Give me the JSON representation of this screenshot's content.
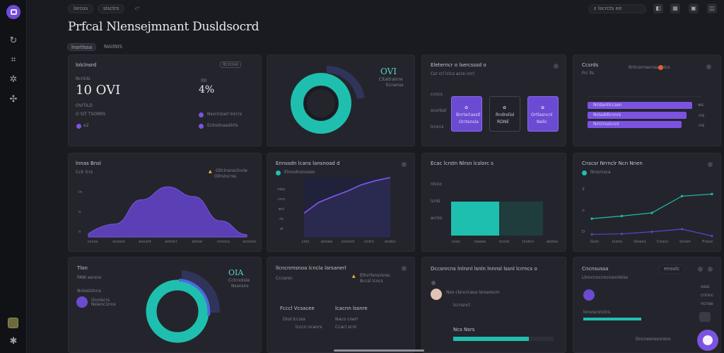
{
  "app": {
    "title": "Prfcal Nlensejmnant Dusldsocrd",
    "brand_color": "#6f4bd8",
    "accent_teal": "#1fbfb0",
    "accent_purple": "#7b53e0"
  },
  "sidebar": {
    "items": [
      {
        "icon": "sync-icon",
        "glyph": "↻"
      },
      {
        "icon": "grid-icon",
        "glyph": "⌗"
      },
      {
        "icon": "settings-icon",
        "glyph": "✲"
      },
      {
        "icon": "team-icon",
        "glyph": "✣"
      },
      {
        "icon": "settings-bottom-icon",
        "glyph": "✱"
      }
    ]
  },
  "topbar": {
    "crumb1": "lsrcos",
    "crumb2": "slsctrs",
    "crumb3": "c°",
    "search": "ɛ lscrcts   ee",
    "badge": "58"
  },
  "tabs": [
    {
      "label": "lnsrtlssa",
      "active": true
    },
    {
      "label": "NAIINIS",
      "active": false
    }
  ],
  "cards": {
    "kpi": {
      "title": "lolclnsrd",
      "sub": "Ncrlnls",
      "value": "10 OVI",
      "meta1": "OVITILD",
      "meta2": "O SIT TSORRS",
      "foot": "e2",
      "box": "ltcrcnin",
      "percent": "4%",
      "leg1": "Nsvrirsiarl lnrcrs",
      "leg2": "Eclnolnaaslirts"
    },
    "donut_top": {
      "value": "OVI",
      "sub1": "Cltaltralnre",
      "sub2": "Ecnanss"
    },
    "kanban": {
      "title": "Eleterncr o lsercsssd o",
      "sub": "Csr rcl lclcs acre nrcl",
      "col1": "Bnrterlasstl",
      "col2": "Rndrellal",
      "col3": "Ortlasncnl",
      "items": [
        "Orrtensla",
        "RDNE",
        "Nellc",
        "Nltna",
        "Pocsa",
        "Neoe"
      ]
    },
    "bars": {
      "title": "Ccsrds",
      "sub": "Frc lls",
      "legend": "Rnlcorrnacnsarlnlcs",
      "labels": [
        "Nrldanllccsen",
        "Noladdlcnnrs",
        "Nrlclrsslcnnl"
      ],
      "values": [
        82,
        78,
        74
      ],
      "ends": [
        "ws",
        "-ns",
        "-ns"
      ]
    },
    "area": {
      "title": "lnnas Bnsl",
      "sub": "Cclr lcrs",
      "warn": "Ollclnsnsclnnle",
      "xticks": [
        "cccss",
        "snosrs",
        "escsnt",
        "onlnnr",
        "olrssr",
        "rcnncs",
        "scnnsn"
      ],
      "ylabels": [
        "ln",
        "n",
        "n"
      ],
      "chart_data": {
        "type": "area",
        "x": [
          0,
          1,
          2,
          3,
          4,
          5,
          6
        ],
        "values": [
          4,
          16,
          46,
          62,
          50,
          20,
          3
        ]
      }
    },
    "line1": {
      "title": "Ennssdn lcans lansnoad d",
      "legend": "Elnnotnsnossn",
      "xticks": [
        "cnlc",
        "onnes",
        "cnnnct",
        "cnlrn",
        "ocdcc"
      ],
      "ylabels": [
        "nlac",
        "cnn",
        "eni",
        "ro",
        "nl"
      ],
      "chart_data": {
        "type": "line",
        "x": [
          0,
          1,
          2,
          3,
          4,
          5,
          6
        ],
        "values": [
          40,
          58,
          68,
          77,
          88,
          95,
          100
        ]
      }
    },
    "stacked": {
      "title": "Ecac lcrstn Nlrsn lcslorc s",
      "ylabels": [
        "nlcco",
        "lcnls",
        "acnlo"
      ],
      "xticks": [
        "cssn",
        "naoes",
        "ncnsl",
        "lcslnn",
        "atolss"
      ],
      "chart_data": {
        "type": "bar",
        "categories": [
          "A",
          "B"
        ],
        "values": [
          100,
          100
        ]
      }
    },
    "line2": {
      "title": "Cnscsr Nrrnclr Ncn Nnen",
      "legend": "lbnsrnsca",
      "ylabels": [
        "3",
        "n",
        "D"
      ],
      "xticks": [
        "Gcln",
        "lcons",
        "Gnecs",
        "Cnscs",
        "tcnon",
        "Fnssc"
      ],
      "chart_data": {
        "type": "line",
        "x": [
          0,
          1,
          2,
          3,
          4
        ],
        "series": [
          {
            "values": [
              35,
              40,
              46,
              78,
              82
            ]
          },
          {
            "values": [
              5,
              6,
              10,
              15,
              2
            ]
          }
        ]
      }
    },
    "profile": {
      "title": "Tlon",
      "sub": "PAW esrsns",
      "line1": "Nnleslslnns",
      "user1": "Onnlscrs",
      "user2": "Nslenc1nns"
    },
    "donut_bottom": {
      "value": "OIA",
      "sub1": "Cclcnolsle",
      "sub2": "Nssnsns"
    },
    "table": {
      "title": "llcncnrnsnoa lcncla larsanerl",
      "sub": "Cccarsn",
      "warn": "Ellnrrlsnsrsnsc",
      "extra": "Bccsl lcncs",
      "col1": "Fcccl Vcsacee",
      "col2": "lcacnn lssnre",
      "rows": [
        [
          "Drol  lccsss",
          "Naco cnerl"
        ],
        [
          "lcccn  ncanrs",
          "Ccacl scnl"
        ]
      ]
    },
    "tasks": {
      "title": "Dccsnrcns lnlrsnl lsnln lnnnsl lssnl lcrrncs o",
      "rows": [
        "Nso clsncrraoa lsrsarocrn",
        "lccnsncl",
        "Ncs Nsrs"
      ],
      "meter": 0.75
    },
    "team": {
      "title": "Cncnsussa",
      "sub": "Llnncnncnncnsnnlslss",
      "chip": "ensolc",
      "labels": [
        "ossc",
        "cnnnc",
        "ncnse"
      ],
      "barlabel": "lonvscnnclcs",
      "foot": "Dncnesnssnnsnc"
    }
  }
}
